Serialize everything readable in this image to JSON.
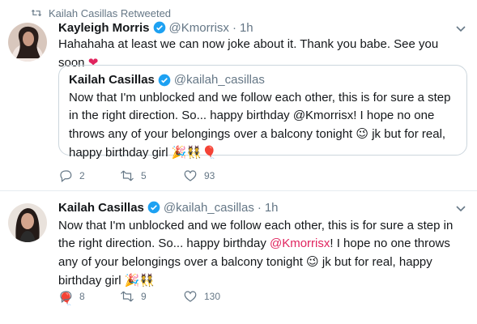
{
  "tweets": [
    {
      "retweet_label": "Kailah Casillas Retweeted",
      "name": "Kayleigh Morris",
      "handle": "@Kmorrisx",
      "dot": "·",
      "time": "1h",
      "text": "Hahahaha at least we can now joke about it. Thank you babe. See you soon",
      "text_emoji": "❤",
      "quote": {
        "name": "Kailah Casillas",
        "handle": "@kailah_casillas",
        "text": "Now that I'm unblocked and we follow each other, this is for sure a step in the right direction. So... happy birthday @Kmorrisx! I hope no one throws any of your belongings over a balcony tonight",
        "emoji_1": "😉",
        "text_2": " jk but for real, happy birthday girl ",
        "emoji_2": "🎉👯🎈"
      },
      "replies": "2",
      "retweets": "5",
      "likes": "93"
    },
    {
      "name": "Kailah Casillas",
      "handle": "@kailah_casillas",
      "dot": "·",
      "time": "1h",
      "text_1": "Now that I'm unblocked and we follow each other, this is for sure a step in the right direction. So... happy birthday ",
      "mention": "@Kmorrisx",
      "text_2": "! I hope no one throws any of your belongings over a balcony tonight ",
      "emoji_1": "😉",
      "text_3": " jk but for real, happy birthday girl ",
      "emoji_2": "🎉👯",
      "emoji_3": "🎈",
      "replies": "8",
      "retweets": "9",
      "likes": "130"
    }
  ],
  "colors": {
    "verified": "#1da1f2",
    "mention": "#e0245e",
    "heart": "#e0245e",
    "muted": "#657786"
  },
  "icons": [
    "retweet-icon",
    "verified-icon",
    "chevron-down-icon",
    "reply-icon",
    "like-icon"
  ]
}
